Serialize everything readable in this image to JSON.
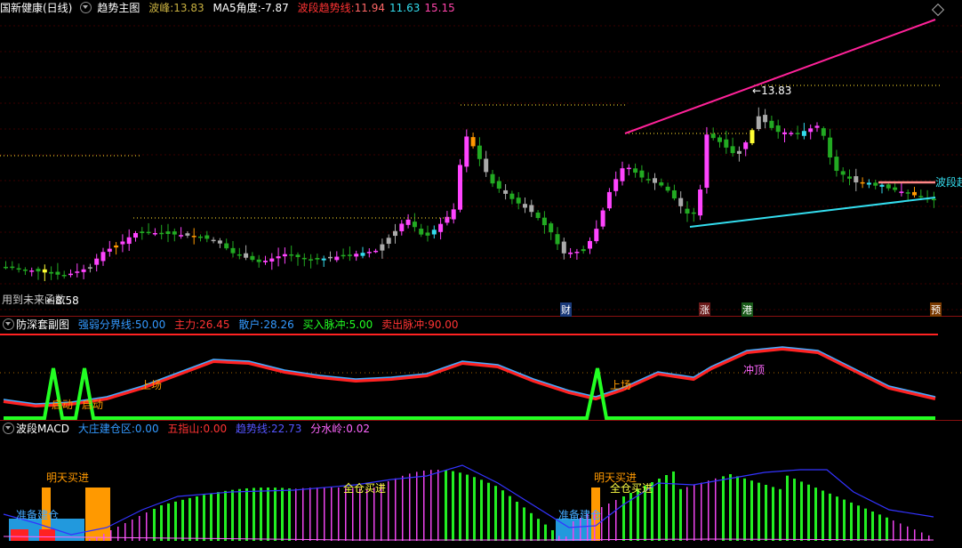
{
  "main": {
    "title": "国新健康(日线)",
    "indicator": "趋势主图",
    "peak_label": "波峰:",
    "peak_value": "13.83",
    "ma5_label": "MA5角度:",
    "ma5_value": "-7.87",
    "band_label": "波段趋势线:",
    "band_v1": "11.94",
    "band_v2": "11.63",
    "band_v3": "15.15",
    "high_annot": "13.83",
    "low_annot": "8.58",
    "bottom_text": "用到未来函数",
    "right_label": "波段起",
    "markers": [
      "财",
      "涨",
      "港",
      "预"
    ]
  },
  "sub1": {
    "title": "防深套副图",
    "items": [
      {
        "label": "强弱分界线:",
        "value": "50.00",
        "color": "#3399ff"
      },
      {
        "label": "主力:",
        "value": "26.45",
        "color": "#ff3333"
      },
      {
        "label": "散户:",
        "value": "28.26",
        "color": "#3399ff"
      },
      {
        "label": "买入脉冲:",
        "value": "5.00",
        "color": "#22ff22"
      },
      {
        "label": "卖出脉冲:",
        "value": "90.00",
        "color": "#ff3333"
      }
    ],
    "annots": [
      "启动",
      "启动",
      "上场",
      "上场",
      "冲顶"
    ]
  },
  "sub2": {
    "title": "波段MACD",
    "items": [
      {
        "label": "大庄建仓区:",
        "value": "0.00",
        "color": "#3399ff"
      },
      {
        "label": "五指山:",
        "value": "0.00",
        "color": "#ff3333"
      },
      {
        "label": "趋势线:",
        "value": "22.73",
        "color": "#5555ff"
      },
      {
        "label": "分水岭:",
        "value": "0.02",
        "color": "#ff66ff"
      }
    ],
    "annots": [
      "明天买进",
      "准备建仓",
      "全仓买进",
      "明天买进",
      "全仓买进",
      "准备建仓"
    ]
  },
  "colors": {
    "up": "#ff44ff",
    "down": "#22aa22",
    "gray": "#aaaaaa",
    "orange": "#ff9900",
    "cyan": "#33ddee",
    "magenta": "#ff2299",
    "gold": "#b8a020"
  }
}
